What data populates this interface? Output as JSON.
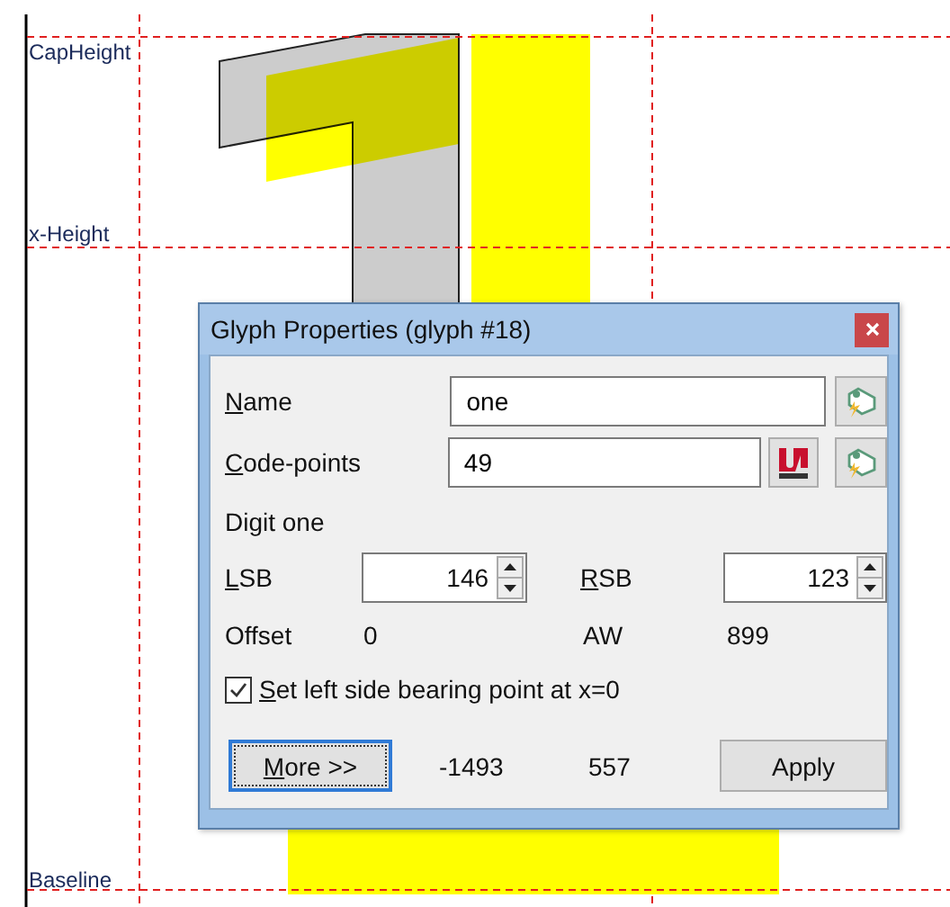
{
  "canvas": {
    "guides": [
      {
        "label": "CapHeight"
      },
      {
        "label": "x-Height"
      },
      {
        "label": "Baseline"
      }
    ]
  },
  "dialog": {
    "title": "Glyph Properties (glyph #18)",
    "name": {
      "label": "Name",
      "value": "one"
    },
    "code_points": {
      "label": "Code-points",
      "value": "49"
    },
    "description": "Digit one",
    "lsb": {
      "label": "LSB",
      "value": "146"
    },
    "rsb": {
      "label": "RSB",
      "value": "123"
    },
    "offset": {
      "label": "Offset",
      "value": "0"
    },
    "aw": {
      "label": "AW",
      "value": "899"
    },
    "checkbox": {
      "label": "Set left side bearing point at x=0",
      "checked": true
    },
    "more_button": {
      "label": "More >>",
      "focused": true
    },
    "readouts": [
      "-1493",
      "557"
    ],
    "apply_button": {
      "label": "Apply"
    }
  }
}
